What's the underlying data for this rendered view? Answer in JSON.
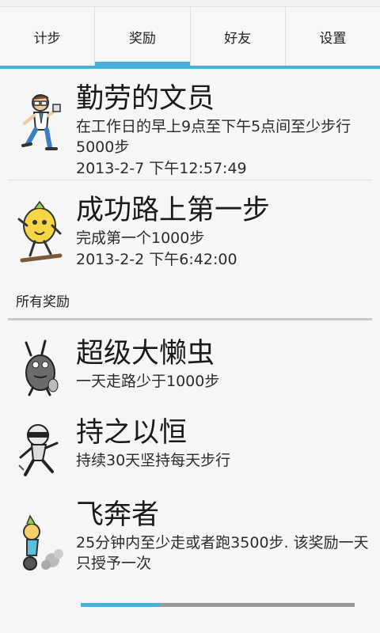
{
  "tabs": [
    {
      "label": "计步",
      "active": false
    },
    {
      "label": "奖励",
      "active": true
    },
    {
      "label": "好友",
      "active": false
    },
    {
      "label": "设置",
      "active": false
    }
  ],
  "earned": [
    {
      "title": "勤劳的文员",
      "desc": "在工作日的早上9点至下午5点间至少步行5000步",
      "date": "2013-2-7 下午12:57:49",
      "icon": "clerk-runner-icon"
    },
    {
      "title": "成功路上第一步",
      "desc": "完成第一个1000步",
      "date": "2013-2-2 下午6:42:00",
      "icon": "lemon-walker-icon"
    }
  ],
  "all_rewards_header": "所有奖励",
  "all": [
    {
      "title": "超级大懒虫",
      "desc": "一天走路少于1000步",
      "icon": "lazy-bug-icon"
    },
    {
      "title": "持之以恒",
      "desc": "持续30天坚持每天步行",
      "icon": "persistent-runner-icon"
    },
    {
      "title": "飞奔者",
      "desc": "25分钟内至少走或者跑3500步. 该奖励一天只授予一次",
      "icon": "sprinter-icon"
    }
  ],
  "scroll_progress": 0.29,
  "colors": {
    "accent": "#45b0dd"
  }
}
